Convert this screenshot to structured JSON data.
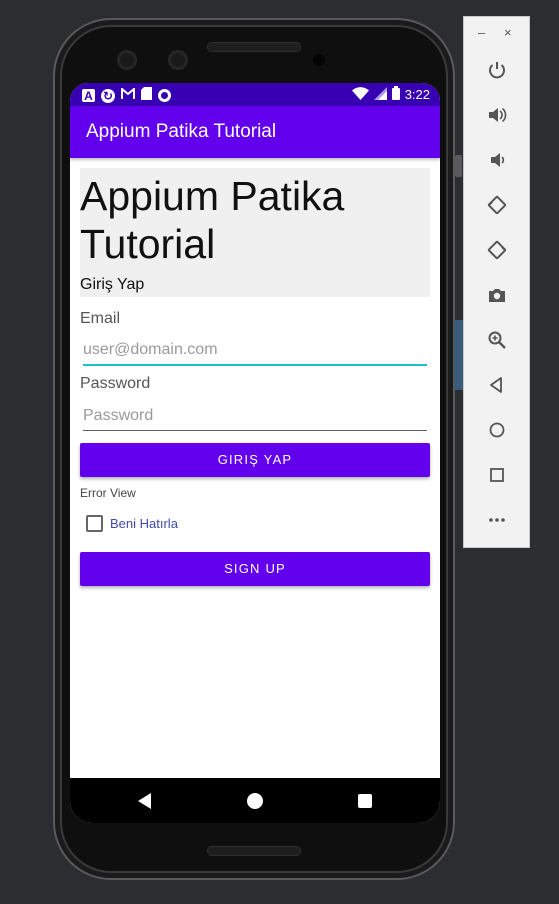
{
  "status_bar": {
    "notif_icons": [
      "a-box-icon",
      "sync-icon",
      "gmail-icon",
      "sd-card-icon",
      "circle-icon"
    ],
    "time": "3:22"
  },
  "app_bar": {
    "title": "Appium Patika Tutorial"
  },
  "hero": {
    "title": "Appium Patika Tutorial",
    "subtitle": "Giriş Yap"
  },
  "form": {
    "email_label": "Email",
    "email_placeholder": "user@domain.com",
    "password_label": "Password",
    "password_placeholder": "Password",
    "login_button": "GIRIŞ YAP",
    "error_text": "Error View",
    "remember_label": "Beni Hatırla",
    "remember_checked": false,
    "signup_button": "SIGN UP"
  },
  "emulator_panel": {
    "controls": [
      "power",
      "volume-up",
      "volume-down",
      "rotate-left",
      "rotate-right",
      "screenshot",
      "zoom",
      "back",
      "home",
      "overview",
      "more"
    ],
    "minimize_label": "–",
    "close_label": "×"
  },
  "colors": {
    "primary": "#6200ee",
    "primary_dark": "#3700b3",
    "accent": "#18c4c8"
  }
}
